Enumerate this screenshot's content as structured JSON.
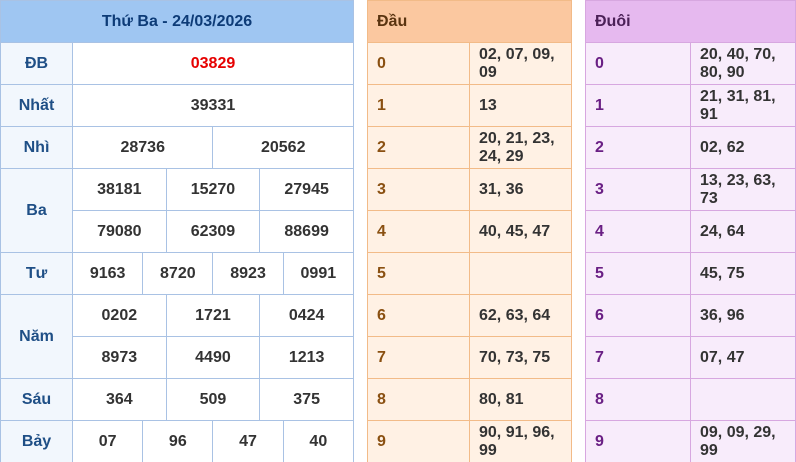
{
  "results": {
    "title": "Thứ Ba - 24/03/2026",
    "rows": [
      {
        "label": "ĐB",
        "numbers": [
          "03829"
        ]
      },
      {
        "label": "Nhất",
        "numbers": [
          "39331"
        ]
      },
      {
        "label": "Nhì",
        "numbers": [
          "28736",
          "20562"
        ]
      },
      {
        "label": "Ba",
        "numbers": [
          "38181",
          "15270",
          "27945",
          "79080",
          "62309",
          "88699"
        ]
      },
      {
        "label": "Tư",
        "numbers": [
          "9163",
          "8720",
          "8923",
          "0991"
        ]
      },
      {
        "label": "Năm",
        "numbers": [
          "0202",
          "1721",
          "0424",
          "8973",
          "4490",
          "1213"
        ]
      },
      {
        "label": "Sáu",
        "numbers": [
          "364",
          "509",
          "375"
        ]
      },
      {
        "label": "Bảy",
        "numbers": [
          "07",
          "96",
          "47",
          "40"
        ]
      }
    ]
  },
  "dau": {
    "header": "Đầu",
    "rows": [
      {
        "digit": "0",
        "values": "02, 07, 09, 09"
      },
      {
        "digit": "1",
        "values": "13"
      },
      {
        "digit": "2",
        "values": "20, 21, 23, 24, 29"
      },
      {
        "digit": "3",
        "values": "31, 36"
      },
      {
        "digit": "4",
        "values": "40, 45, 47"
      },
      {
        "digit": "5",
        "values": ""
      },
      {
        "digit": "6",
        "values": "62, 63, 64"
      },
      {
        "digit": "7",
        "values": "70, 73, 75"
      },
      {
        "digit": "8",
        "values": "80, 81"
      },
      {
        "digit": "9",
        "values": "90, 91, 96, 99"
      }
    ]
  },
  "duoi": {
    "header": "Đuôi",
    "rows": [
      {
        "digit": "0",
        "values": "20, 40, 70, 80, 90"
      },
      {
        "digit": "1",
        "values": "21, 31, 81, 91"
      },
      {
        "digit": "2",
        "values": "02, 62"
      },
      {
        "digit": "3",
        "values": "13, 23, 63, 73"
      },
      {
        "digit": "4",
        "values": "24, 64"
      },
      {
        "digit": "5",
        "values": "45, 75"
      },
      {
        "digit": "6",
        "values": "36, 96"
      },
      {
        "digit": "7",
        "values": "07, 47"
      },
      {
        "digit": "8",
        "values": ""
      },
      {
        "digit": "9",
        "values": "09, 09, 29, 99"
      }
    ]
  },
  "colors": {
    "header_blue": "#9fc6f2",
    "special_red": "#e60000",
    "dau_header": "#fbc8a0",
    "duoi_header": "#e6b9ef"
  }
}
